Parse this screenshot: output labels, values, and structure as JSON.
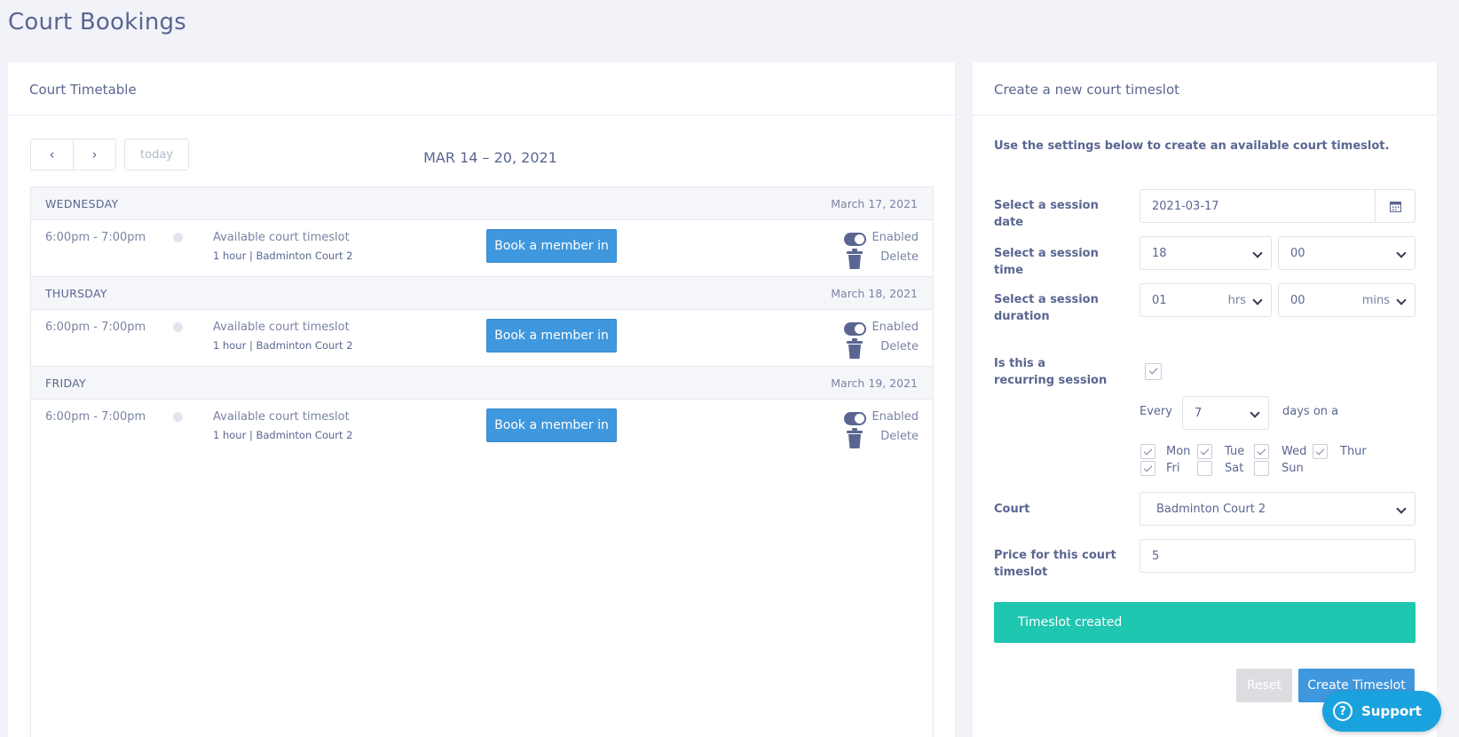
{
  "page": {
    "title": "Court Bookings"
  },
  "timetable": {
    "header": "Court Timetable",
    "prev_icon": "‹",
    "next_icon": "›",
    "today_label": "today",
    "range_title": "MAR 14 – 20, 2021",
    "days": [
      {
        "name": "WEDNESDAY",
        "date": "March 17, 2021",
        "event": {
          "time": "6:00pm - 7:00pm",
          "title": "Available court timeslot",
          "subtitle": "1 hour | Badminton Court 2",
          "book_label": "Book a member in",
          "enabled_label": "Enabled",
          "delete_label": "Delete"
        }
      },
      {
        "name": "THURSDAY",
        "date": "March 18, 2021",
        "event": {
          "time": "6:00pm - 7:00pm",
          "title": "Available court timeslot",
          "subtitle": "1 hour | Badminton Court 2",
          "book_label": "Book a member in",
          "enabled_label": "Enabled",
          "delete_label": "Delete"
        }
      },
      {
        "name": "FRIDAY",
        "date": "March 19, 2021",
        "event": {
          "time": "6:00pm - 7:00pm",
          "title": "Available court timeslot",
          "subtitle": "1 hour | Badminton Court 2",
          "book_label": "Book a member in",
          "enabled_label": "Enabled",
          "delete_label": "Delete"
        }
      }
    ]
  },
  "form": {
    "header": "Create a new court timeslot",
    "intro": "Use the settings below to create an available court timeslot.",
    "date_label": "Select a session date",
    "date_value": "2021-03-17",
    "time_label": "Select a session time",
    "time_hour": "18",
    "time_minute": "00",
    "duration_label": "Select a session duration",
    "duration_hours": "01",
    "duration_hours_unit": "hrs",
    "duration_mins": "00",
    "duration_mins_unit": "mins",
    "recurring_label": "Is this a recurring session",
    "recurring_checked": true,
    "every_label": "Every",
    "every_value": "7",
    "days_on_label": "days on a",
    "weekdays": [
      {
        "label": "Mon",
        "checked": true
      },
      {
        "label": "Tue",
        "checked": true
      },
      {
        "label": "Wed",
        "checked": true
      },
      {
        "label": "Thur",
        "checked": true
      },
      {
        "label": "Fri",
        "checked": true
      },
      {
        "label": "Sat",
        "checked": false
      },
      {
        "label": "Sun",
        "checked": false
      }
    ],
    "court_label": "Court",
    "court_value": "Badminton Court 2",
    "price_label": "Price for this court timeslot",
    "price_value": "5",
    "alert": "Timeslot created",
    "reset_label": "Reset",
    "create_label": "Create Timeslot"
  },
  "support": {
    "label": "Support",
    "icon": "?"
  },
  "colors": {
    "primary": "#3f97dd",
    "success": "#1fc6b0",
    "text": "#5a6691",
    "support": "#1aa2de"
  }
}
